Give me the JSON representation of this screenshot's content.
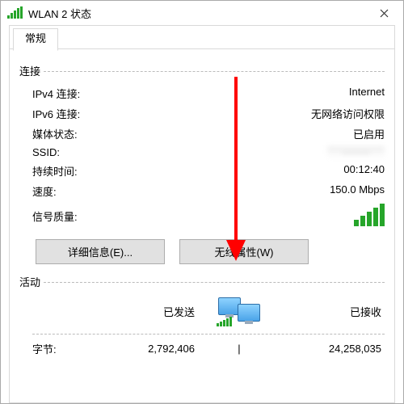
{
  "titlebar": {
    "title": "WLAN 2 状态"
  },
  "tabs": {
    "general": "常规"
  },
  "sections": {
    "connection": "连接",
    "activity": "活动"
  },
  "conn": {
    "ipv4_label": "IPv4 连接:",
    "ipv4_value": "Internet",
    "ipv6_label": "IPv6 连接:",
    "ipv6_value": "无网络访问权限",
    "media_label": "媒体状态:",
    "media_value": "已启用",
    "ssid_label": "SSID:",
    "ssid_value": "········",
    "duration_label": "持续时间:",
    "duration_value": "00:12:40",
    "speed_label": "速度:",
    "speed_value": "150.0 Mbps",
    "signal_label": "信号质量:"
  },
  "buttons": {
    "details": "详细信息(E)...",
    "wireless_props": "无线属性(W)"
  },
  "activity": {
    "sent_label": "已发送",
    "recv_label": "已接收",
    "bytes_label": "字节:",
    "sent_value": "2,792,406",
    "recv_value": "24,258,035"
  }
}
